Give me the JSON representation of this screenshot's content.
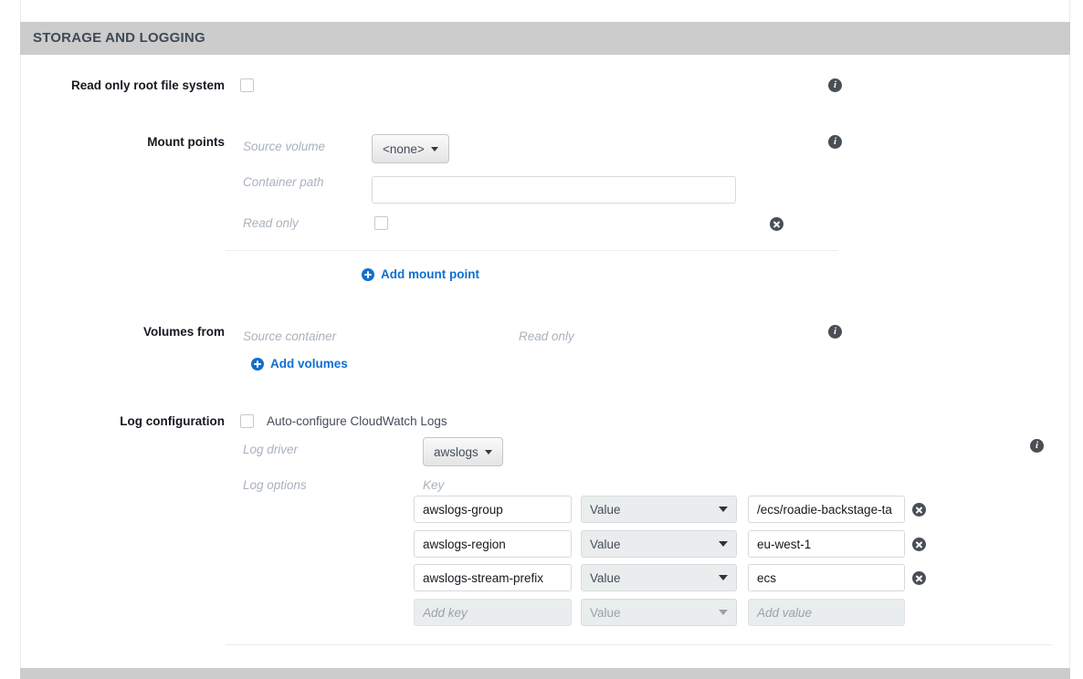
{
  "section": {
    "title": "STORAGE AND LOGGING"
  },
  "read_only_root": {
    "label": "Read only root file system",
    "checked": false,
    "info_icon": "info-icon"
  },
  "mount_points": {
    "label": "Mount points",
    "info_icon": "info-icon",
    "fields": {
      "source_volume_label": "Source volume",
      "source_volume_value": "<none>",
      "container_path_label": "Container path",
      "container_path_value": "",
      "container_path_placeholder": "",
      "read_only_label": "Read only",
      "read_only_checked": false
    },
    "remove_icon": "close-circle-icon",
    "add_link": "Add mount point",
    "add_icon": "plus-circle-icon"
  },
  "volumes_from": {
    "label": "Volumes from",
    "info_icon": "info-icon",
    "col_source_container": "Source container",
    "col_read_only": "Read only",
    "add_link": "Add volumes",
    "add_icon": "plus-circle-icon"
  },
  "log_configuration": {
    "label": "Log configuration",
    "auto_configure_label": "Auto-configure CloudWatch Logs",
    "auto_configure_checked": false,
    "info_icon": "info-icon",
    "log_driver_label": "Log driver",
    "log_driver_value": "awslogs",
    "log_options_label": "Log options",
    "key_column_header": "Key",
    "rows": [
      {
        "key": "awslogs-group",
        "type": "Value",
        "value": "/ecs/roadie-backstage-ta",
        "remove_icon": "close-circle-icon",
        "removable": true,
        "placeholder_row": false
      },
      {
        "key": "awslogs-region",
        "type": "Value",
        "value": "eu-west-1",
        "remove_icon": "close-circle-icon",
        "removable": true,
        "placeholder_row": false
      },
      {
        "key": "awslogs-stream-prefix",
        "type": "Value",
        "value": "ecs",
        "remove_icon": "close-circle-icon",
        "removable": true,
        "placeholder_row": false
      },
      {
        "key": "",
        "key_placeholder": "Add key",
        "type": "Value",
        "value": "",
        "value_placeholder": "Add value",
        "removable": false,
        "placeholder_row": true
      }
    ]
  },
  "colors": {
    "header_bg": "#cccccc",
    "link_blue": "#0f6fd1",
    "icon_dark": "#4a4f55",
    "muted_text": "#aab2bd",
    "panel_border": "#e4eef2"
  }
}
